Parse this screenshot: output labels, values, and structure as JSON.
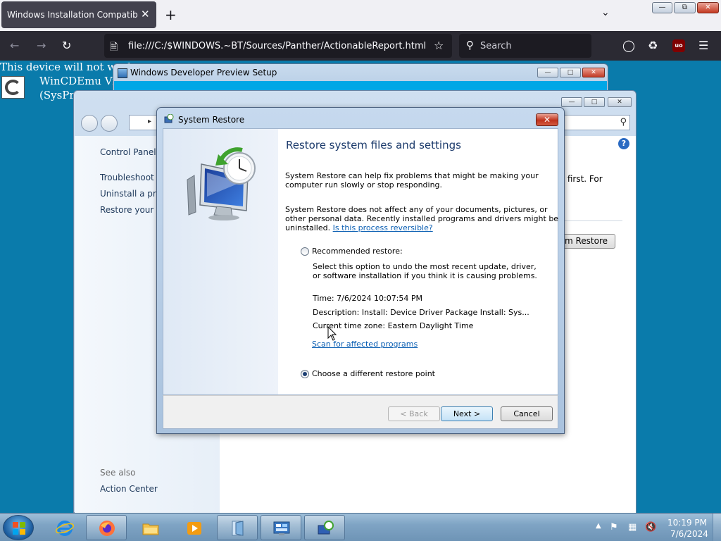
{
  "browser": {
    "tab_title": "Windows Installation Compatibility",
    "tab_close": "✕",
    "new_tab": "+",
    "tab_list": "⌄",
    "url": "file:///C:/$WINDOWS.~BT/Sources/Panther/ActionableReport.html",
    "search_placeholder": "Search",
    "ublock_label": "uo"
  },
  "page": {
    "warning_text": "This device will not work",
    "app_name": "WinCDEmu Vir",
    "app_sub": "(SysPro"
  },
  "setup_window": {
    "title": "Windows Developer Preview Setup"
  },
  "control_panel": {
    "sidebar": {
      "home": "Control Panel H",
      "troubleshoot": "Troubleshoot a",
      "uninstall": "Uninstall a prog",
      "restore_files": "Restore your fil",
      "see_also": "See also",
      "action_center": "Action Center"
    },
    "right_text": "ry first. For",
    "open_restore_button": "em Restore"
  },
  "system_restore": {
    "title": "System Restore",
    "heading": "Restore system files and settings",
    "p1_line1": "System Restore can help fix problems that might be making your",
    "p1_line2": "computer run slowly or stop responding.",
    "p2_line1": "System Restore does not affect any of your documents, pictures, or",
    "p2_line2": "other personal data. Recently installed programs and drivers might be",
    "p2_line3_prefix": "uninstalled.",
    "p2_link": "Is this process reversible?",
    "recommended_label": "Recommended restore:",
    "recommended_desc_line1": "Select this option to undo the most recent update, driver,",
    "recommended_desc_line2": "or software installation if you think it is causing problems.",
    "time": "Time: 7/6/2024 10:07:54 PM",
    "description": "Description: Install: Device Driver Package Install: Sys...",
    "timezone": "Current time zone: Eastern Daylight Time",
    "scan_link": "Scan for affected programs",
    "different_label": "Choose a different restore point",
    "recommended_selected": false,
    "different_selected": true,
    "back_button": "< Back",
    "next_button": "Next >",
    "cancel_button": "Cancel"
  },
  "taskbar": {
    "clock_time": "10:19 PM",
    "clock_date": "7/6/2024"
  },
  "colors": {
    "desktop": "#0a7bab",
    "firefox_dark": "#2b2a33",
    "link": "#0b5fb3",
    "heading": "#1b3a6b"
  }
}
